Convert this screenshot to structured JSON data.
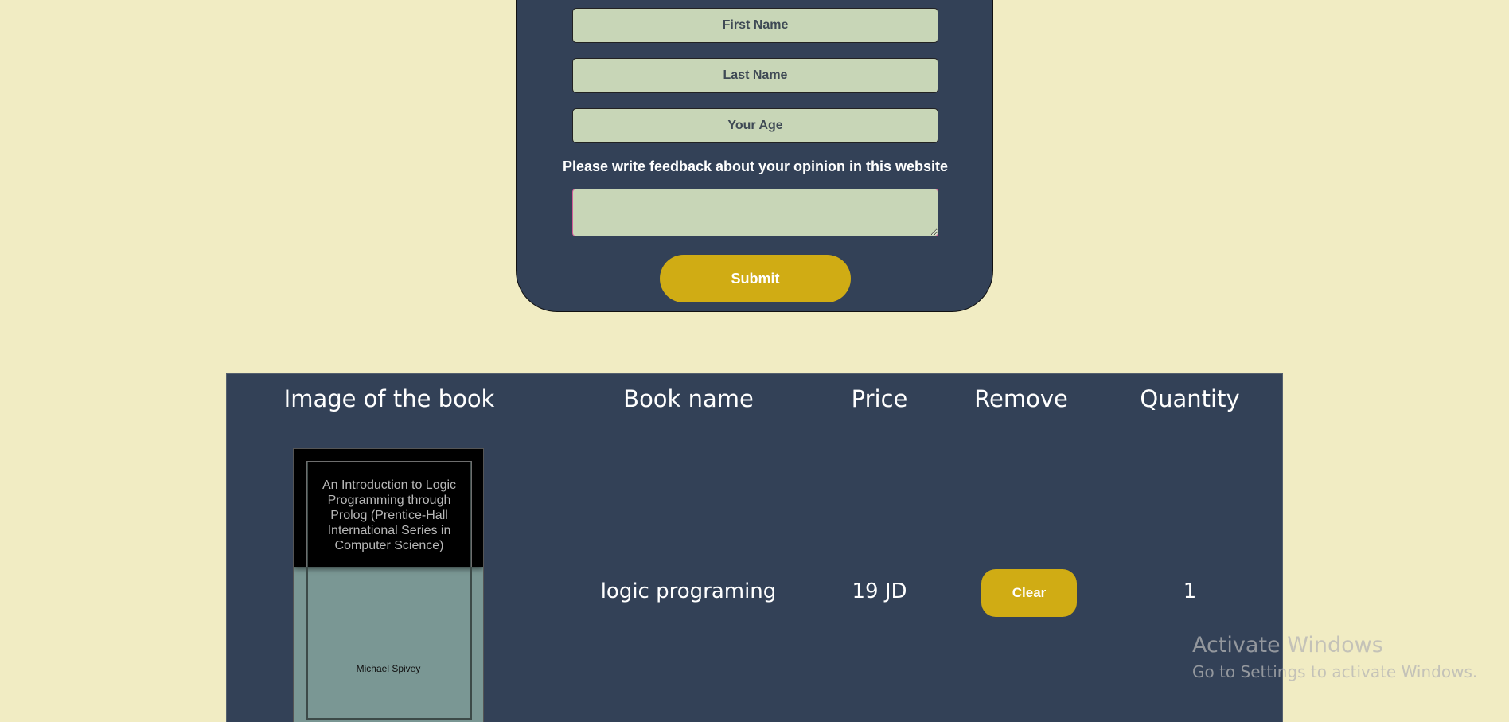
{
  "form": {
    "first_name_placeholder": "First Name",
    "last_name_placeholder": "Last Name",
    "age_placeholder": "Your Age",
    "feedback_label": "Please write feedback about your opinion in this website",
    "feedback_value": "",
    "submit_label": "Submit"
  },
  "cart": {
    "headers": {
      "image": "Image of the book",
      "name": "Book name",
      "price": "Price",
      "remove": "Remove",
      "quantity": "Quantity"
    },
    "rows": [
      {
        "cover_title": "An Introduction to Logic Programming through Prolog (Prentice-Hall International Series in Computer Science)",
        "cover_author": "Michael Spivey",
        "name": "logic programing",
        "price": "19 JD",
        "remove_label": "Clear",
        "quantity": "1"
      }
    ]
  },
  "watermark": {
    "title": "Activate Windows",
    "subtitle": "Go to Settings to activate Windows."
  },
  "colors": {
    "page_background": "#f1ecc3",
    "panel": "#334157",
    "input": "#c8d6b7",
    "accent": "#d0ac14"
  }
}
